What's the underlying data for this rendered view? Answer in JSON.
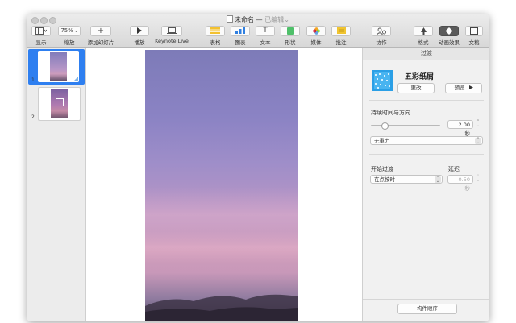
{
  "window": {
    "title": "未命名",
    "title_sep": " — ",
    "edited": "已编辑",
    "edited_chevron": "⌄"
  },
  "toolbar": {
    "view": {
      "icon": "sidebar-view-icon",
      "label": "显示"
    },
    "zoom": {
      "value": "75%",
      "label": "缩放"
    },
    "add_slide": {
      "icon": "plus-icon",
      "label": "添加幻灯片"
    },
    "play": {
      "icon": "play-icon",
      "label": "播放"
    },
    "keynote_live": {
      "icon": "keynote-live-icon",
      "label": "Keynote Live"
    },
    "table": {
      "icon": "table-icon",
      "label": "表格",
      "color": "#f3c12f"
    },
    "chart": {
      "icon": "chart-icon",
      "label": "图表",
      "color": "#2f7fe0"
    },
    "text": {
      "icon": "text-icon",
      "label": "文本",
      "glyph": "T"
    },
    "shape": {
      "icon": "shape-icon",
      "label": "形状",
      "color": "#4fc06a"
    },
    "media": {
      "icon": "photos-icon",
      "label": "媒体"
    },
    "comment": {
      "icon": "comment-icon",
      "label": "批注",
      "color": "#f0c430"
    },
    "collaborate": {
      "icon": "collaborate-icon",
      "label": "协作"
    },
    "format": {
      "icon": "format-brush-icon",
      "label": "格式"
    },
    "animate": {
      "icon": "animate-diamond-icon",
      "label": "动画效果"
    },
    "document": {
      "icon": "document-icon",
      "label": "文稿"
    }
  },
  "navigator": {
    "slides": [
      {
        "number": "1"
      },
      {
        "number": "2"
      }
    ]
  },
  "inspector": {
    "tab": "过渡",
    "effect_name": "五彩纸屑",
    "change_button": "更改",
    "preview_button": "预览",
    "preview_icon": "play-triangle-icon",
    "duration_section": "持续时间与方向",
    "duration_value": "2.00 秒",
    "duration_fraction": 0.2,
    "gravity_option": "无重力",
    "start_section": "开始过渡",
    "start_option": "在点按时",
    "delay_section": "延迟",
    "delay_value": "0.50 秒",
    "build_order_button": "构件顺序"
  },
  "colors": {
    "selection": "#2e7ff0",
    "effect_thumb": "#2a9fe6"
  }
}
